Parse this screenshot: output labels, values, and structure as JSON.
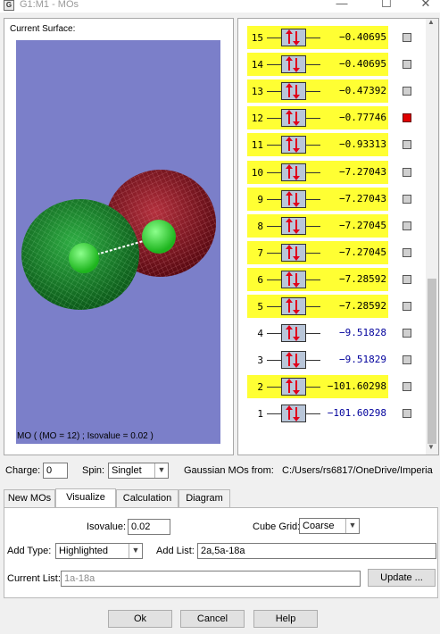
{
  "window": {
    "title": "G1:M1 - MOs",
    "minimize": "—",
    "maximize": "☐",
    "close": "✕"
  },
  "left_panel": {
    "title": "Current Surface:",
    "caption": "MO ( (MO = 12) ; Isovalue = 0.02 )"
  },
  "orbitals": [
    {
      "num": "15",
      "energy": "−0.40695",
      "highlighted": true,
      "occupied": true,
      "selected": false
    },
    {
      "num": "14",
      "energy": "−0.40695",
      "highlighted": true,
      "occupied": true,
      "selected": false
    },
    {
      "num": "13",
      "energy": "−0.47392",
      "highlighted": true,
      "occupied": true,
      "selected": false
    },
    {
      "num": "12",
      "energy": "−0.77746",
      "highlighted": true,
      "occupied": true,
      "selected": true
    },
    {
      "num": "11",
      "energy": "−0.93313",
      "highlighted": true,
      "occupied": true,
      "selected": false
    },
    {
      "num": "10",
      "energy": "−7.27043",
      "highlighted": true,
      "occupied": true,
      "selected": false
    },
    {
      "num": "9",
      "energy": "−7.27043",
      "highlighted": true,
      "occupied": true,
      "selected": false
    },
    {
      "num": "8",
      "energy": "−7.27045",
      "highlighted": true,
      "occupied": true,
      "selected": false
    },
    {
      "num": "7",
      "energy": "−7.27045",
      "highlighted": true,
      "occupied": true,
      "selected": false
    },
    {
      "num": "6",
      "energy": "−7.28592",
      "highlighted": true,
      "occupied": true,
      "selected": false
    },
    {
      "num": "5",
      "energy": "−7.28592",
      "highlighted": true,
      "occupied": true,
      "selected": false
    },
    {
      "num": "4",
      "energy": "−9.51828",
      "highlighted": false,
      "occupied": true,
      "selected": false
    },
    {
      "num": "3",
      "energy": "−9.51829",
      "highlighted": false,
      "occupied": true,
      "selected": false
    },
    {
      "num": "2",
      "energy": "−101.60298",
      "highlighted": true,
      "occupied": true,
      "selected": false
    },
    {
      "num": "1",
      "energy": "−101.60298",
      "highlighted": false,
      "occupied": true,
      "selected": false
    }
  ],
  "controls": {
    "charge_label": "Charge:",
    "charge_value": "0",
    "spin_label": "Spin:",
    "spin_value": "Singlet",
    "source_label": "Gaussian MOs from:",
    "source_path": "C:/Users/rs6817/OneDrive/Imperia"
  },
  "tabs": [
    {
      "label": "New MOs",
      "active": false
    },
    {
      "label": "Visualize",
      "active": true
    },
    {
      "label": "Calculation",
      "active": false
    },
    {
      "label": "Diagram",
      "active": false
    }
  ],
  "visualize": {
    "isovalue_label": "Isovalue:",
    "isovalue_value": "0.02",
    "cube_grid_label": "Cube Grid:",
    "cube_grid_value": "Coarse",
    "add_type_label": "Add Type:",
    "add_type_value": "Highlighted",
    "add_list_label": "Add List:",
    "add_list_value": "2a,5a-18a",
    "current_list_label": "Current List:",
    "current_list_value": "1a-18a",
    "update_label": "Update ..."
  },
  "footer": {
    "ok": "Ok",
    "cancel": "Cancel",
    "help": "Help"
  },
  "colors": {
    "highlight": "#ffff33",
    "selected": "#e00000",
    "viewport_bg": "#7b7fc9",
    "lobe_green": "#1f8a2e",
    "lobe_red": "#8a1420"
  }
}
